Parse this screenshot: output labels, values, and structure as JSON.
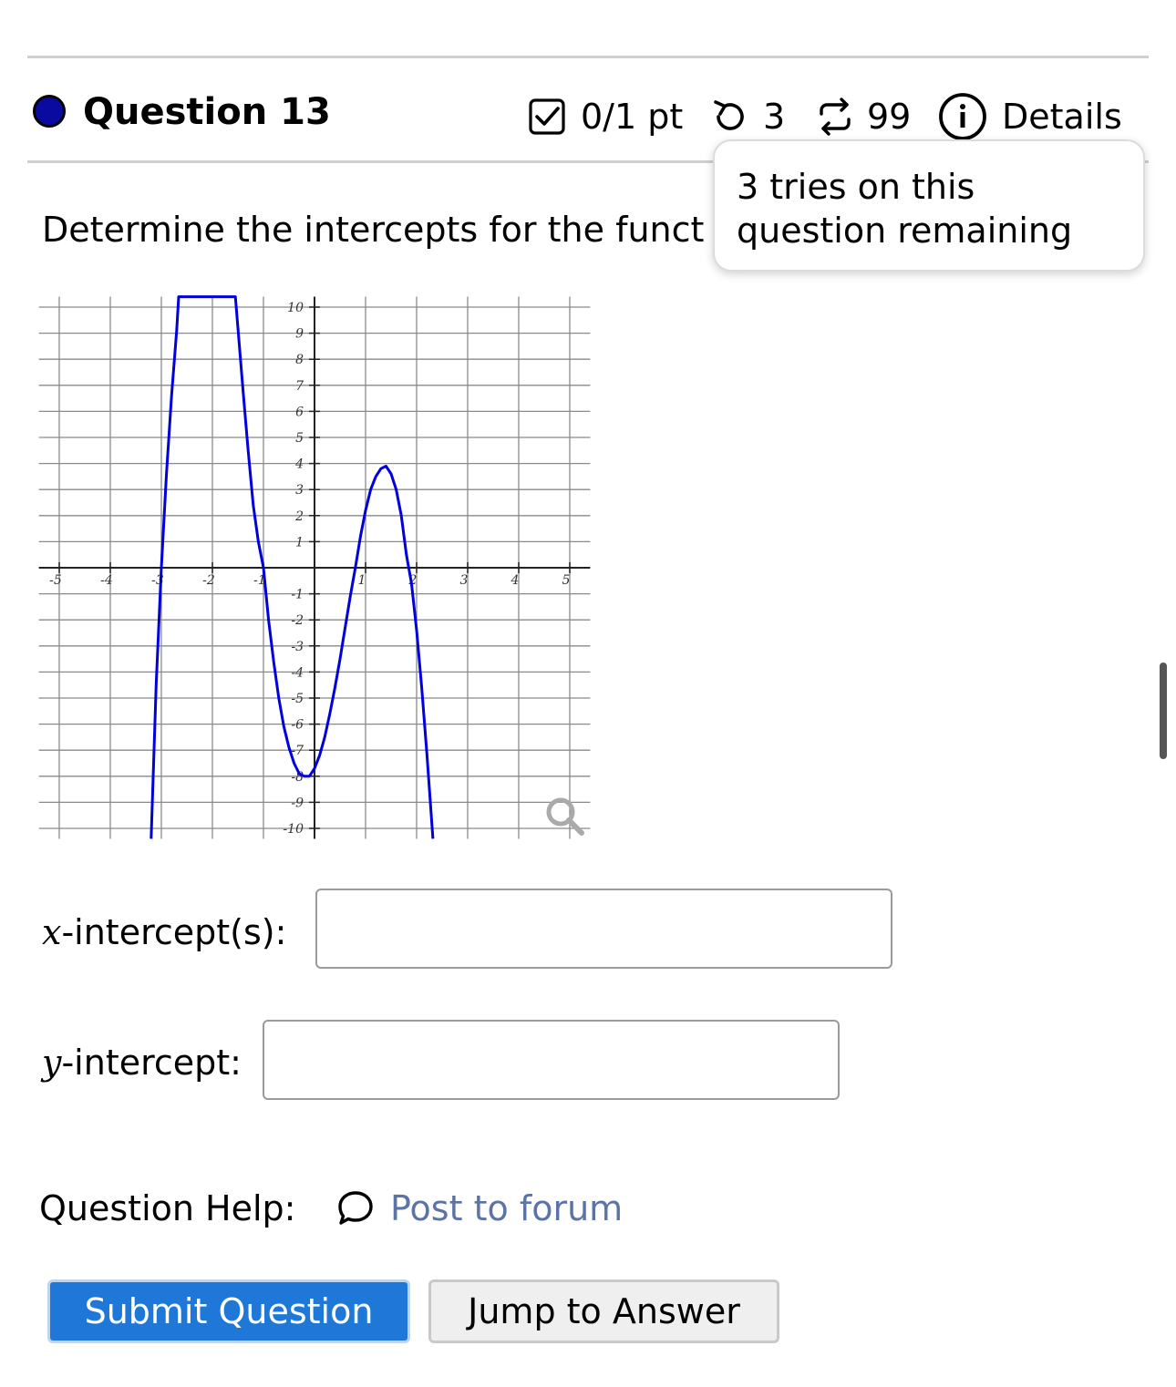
{
  "header": {
    "question_title": "Question 13",
    "score": "0/1 pt",
    "tries": "3",
    "submissions": "99",
    "details_label": "Details",
    "accent_color": "#0a0aa0"
  },
  "tooltip": {
    "line1": "3 tries on this",
    "line2": "question remaining"
  },
  "prompt": {
    "text": "Determine the intercepts for the funct"
  },
  "chart_data": {
    "type": "line",
    "title": "",
    "xlabel": "",
    "ylabel": "",
    "xlim": [
      -5.4,
      5.4
    ],
    "ylim": [
      -10.4,
      10.4
    ],
    "grid": true,
    "x_ticks": [
      -5,
      -4,
      -3,
      -2,
      -1,
      1,
      2,
      3,
      4,
      5
    ],
    "y_ticks": [
      -10,
      -9,
      -8,
      -7,
      -6,
      -5,
      -4,
      -3,
      -2,
      -1,
      1,
      2,
      3,
      4,
      5,
      6,
      7,
      8,
      9,
      10
    ],
    "series": [
      {
        "color": "#0000dd",
        "points": [
          [
            -3.2,
            -10.4
          ],
          [
            -3.1,
            -4.4
          ],
          [
            -3.0,
            0
          ],
          [
            -2.9,
            3.6
          ],
          [
            -2.8,
            6.6
          ],
          [
            -2.7,
            9.1
          ],
          [
            -2.66,
            10.4
          ],
          [
            -1.55,
            10.4
          ],
          [
            -1.5,
            9.2
          ],
          [
            -1.4,
            6.8
          ],
          [
            -1.3,
            4.5
          ],
          [
            -1.2,
            2.4
          ],
          [
            -1.1,
            1.0
          ],
          [
            -1.0,
            0
          ],
          [
            -0.9,
            -2.0
          ],
          [
            -0.8,
            -3.6
          ],
          [
            -0.7,
            -5.0
          ],
          [
            -0.6,
            -6.1
          ],
          [
            -0.5,
            -6.9
          ],
          [
            -0.4,
            -7.5
          ],
          [
            -0.3,
            -7.9
          ],
          [
            -0.2,
            -8.0
          ],
          [
            -0.1,
            -8.0
          ],
          [
            0.0,
            -7.7
          ],
          [
            0.1,
            -7.2
          ],
          [
            0.2,
            -6.5
          ],
          [
            0.3,
            -5.6
          ],
          [
            0.4,
            -4.6
          ],
          [
            0.5,
            -3.5
          ],
          [
            0.6,
            -2.3
          ],
          [
            0.7,
            -1.1
          ],
          [
            0.8,
            0
          ],
          [
            0.9,
            1.2
          ],
          [
            1.0,
            2.2
          ],
          [
            1.1,
            3.0
          ],
          [
            1.2,
            3.5
          ],
          [
            1.3,
            3.8
          ],
          [
            1.4,
            3.9
          ],
          [
            1.5,
            3.6
          ],
          [
            1.6,
            3.0
          ],
          [
            1.7,
            2.0
          ],
          [
            1.8,
            0.5
          ],
          [
            1.9,
            -0.6
          ],
          [
            2.0,
            -2.4
          ],
          [
            2.1,
            -4.6
          ],
          [
            2.2,
            -7.1
          ],
          [
            2.32,
            -10.4
          ]
        ]
      }
    ]
  },
  "fields": {
    "x_var": "x",
    "x_label_rest": "-intercept(s):",
    "x_value": "",
    "y_var": "y",
    "y_label_rest": "-intercept:",
    "y_value": ""
  },
  "help": {
    "label": "Question Help:",
    "forum_link": "Post to forum",
    "link_color": "#5b73a6"
  },
  "buttons": {
    "submit": "Submit Question",
    "jump": "Jump to Answer",
    "submit_color": "#1f78d8"
  }
}
